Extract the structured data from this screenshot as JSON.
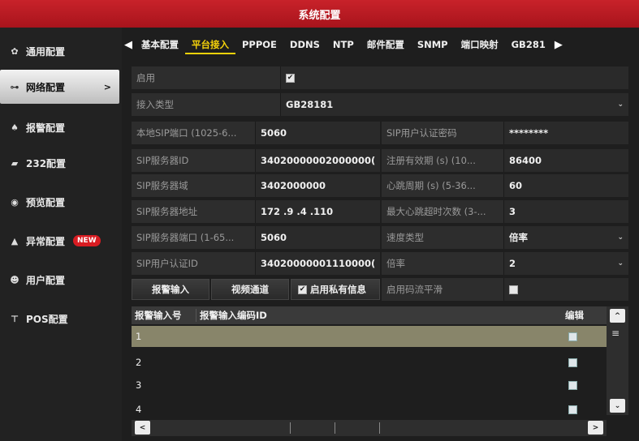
{
  "window": {
    "title": "系统配置"
  },
  "sidebar": {
    "items": [
      {
        "label": "通用配置",
        "icon": "gear-icon",
        "glyph": "✿"
      },
      {
        "label": "网络配置",
        "icon": "network-icon",
        "glyph": "⊶",
        "active": true
      },
      {
        "label": "报警配置",
        "icon": "alarm-bell-icon",
        "glyph": "♠"
      },
      {
        "label": "232配置",
        "icon": "serial-port-icon",
        "glyph": "▰"
      },
      {
        "label": "预览配置",
        "icon": "eye-icon",
        "glyph": "◉"
      },
      {
        "label": "异常配置",
        "icon": "warning-icon",
        "glyph": "▲",
        "badge": "NEW"
      },
      {
        "label": "用户配置",
        "icon": "users-icon",
        "glyph": "☻"
      },
      {
        "label": "POS配置",
        "icon": "pos-icon",
        "glyph": "⊤"
      }
    ]
  },
  "tabs": [
    {
      "label": "基本配置"
    },
    {
      "label": "平台接入",
      "active": true
    },
    {
      "label": "PPPOE"
    },
    {
      "label": "DDNS"
    },
    {
      "label": "NTP"
    },
    {
      "label": "邮件配置"
    },
    {
      "label": "SNMP"
    },
    {
      "label": "端口映射"
    },
    {
      "label": "GB281"
    }
  ],
  "form": {
    "enable_label": "启用",
    "enable_checked": "✔",
    "access_type_label": "接入类型",
    "access_type_value": "GB28181",
    "local_port_label": "本地SIP端口 (1025-6...",
    "local_port_value": "5060",
    "server_id_label": "SIP服务器ID",
    "server_id_value": "34020000002000000(",
    "server_domain_label": "SIP服务器域",
    "server_domain_value": "3402000000",
    "server_addr_label": "SIP服务器地址",
    "server_addr_value": "172 .9    .4     .110",
    "server_port_label": "SIP服务器端口 (1-65...",
    "server_port_value": "5060",
    "user_id_label": "SIP用户认证ID",
    "user_id_value": "34020000001110000(",
    "password_label": "SIP用户认证密码",
    "password_value": "********",
    "expire_label": "注册有效期 (s) (10...",
    "expire_value": "86400",
    "heartbeat_label": "心跳周期 (s) (5-36...",
    "heartbeat_value": "60",
    "max_timeout_label": "最大心跳超时次数 (3-...",
    "max_timeout_value": "3",
    "speed_type_label": "速度类型",
    "speed_type_value": "倍率",
    "rate_label": "倍率",
    "rate_value": "2",
    "smooth_label": "启用码流平滑",
    "dropdown_glyph": "⌄"
  },
  "buttons": {
    "alarm_input": "报警输入",
    "video_channel": "视频通道",
    "private_info": "启用私有信息"
  },
  "table": {
    "headers": [
      "报警输入号",
      "报警输入编码ID",
      "编辑"
    ],
    "rows": [
      {
        "num": "1"
      },
      {
        "num": "2"
      },
      {
        "num": "3"
      },
      {
        "num": "4"
      }
    ]
  },
  "scroll": {
    "up": "^",
    "down": "⌄",
    "left": "<",
    "right": ">",
    "menu": "≡"
  }
}
